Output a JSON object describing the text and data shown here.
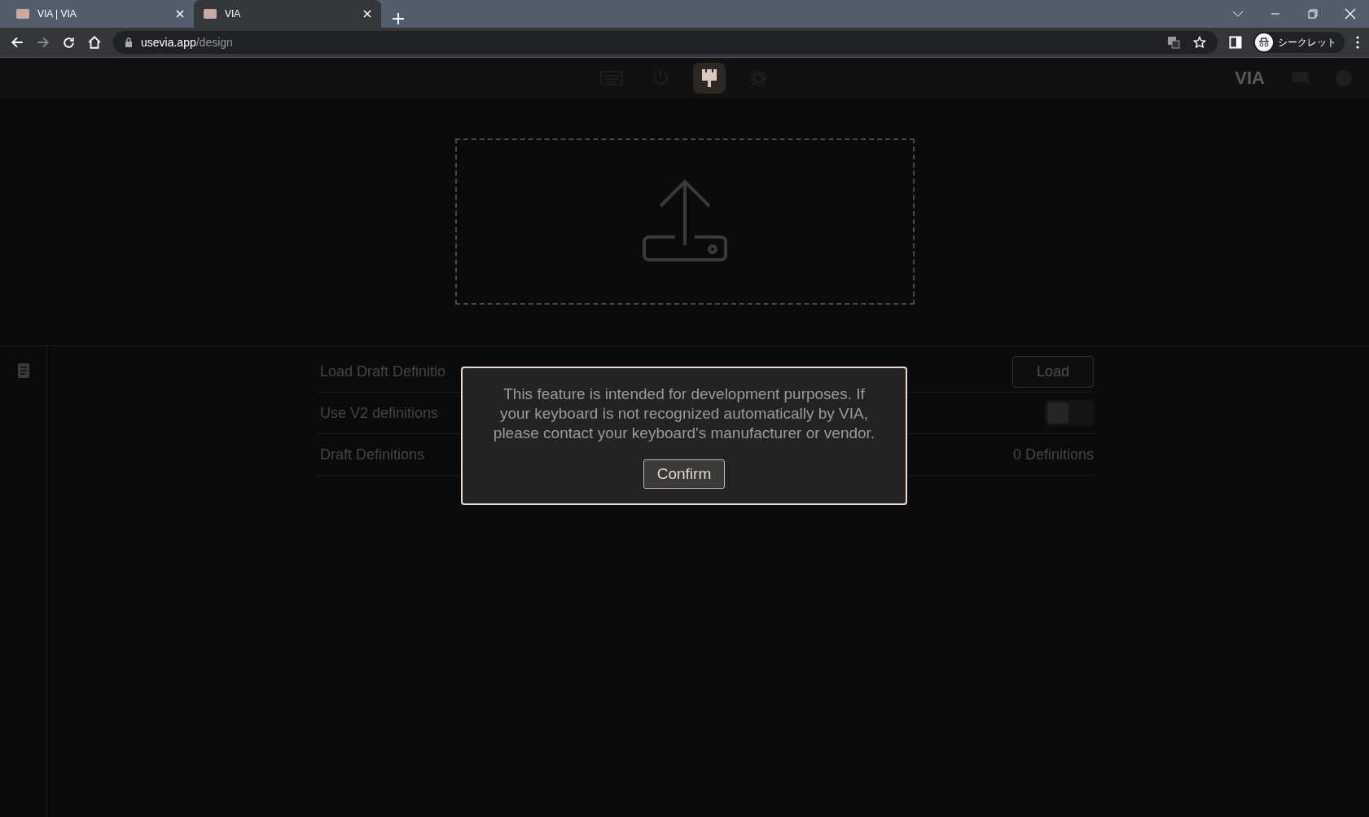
{
  "browser": {
    "tabs": [
      {
        "title": "VIA | VIA",
        "selected": false
      },
      {
        "title": "VIA",
        "selected": true
      }
    ],
    "url": {
      "host": "usevia.app",
      "path": "/design"
    },
    "profile": "シークレット"
  },
  "app": {
    "nav": [
      {
        "kind": "keyboard",
        "selected": false
      },
      {
        "kind": "plug",
        "selected": false
      },
      {
        "kind": "brush",
        "selected": true
      },
      {
        "kind": "gear",
        "selected": false
      }
    ],
    "logo": "VIA"
  },
  "settings": [
    {
      "kind": "button",
      "label": "Load Draft Definitio",
      "button": "Load"
    },
    {
      "kind": "toggle",
      "label": "Use V2 definitions",
      "on": false
    },
    {
      "kind": "value",
      "label": "Draft Definitions",
      "value": "0 Definitions"
    }
  ],
  "dialog": {
    "message": "This feature is intended for development purposes. If your keyboard is not recognized automatically by VIA, please contact your keyboard's manufacturer or vendor.",
    "button": "Confirm"
  }
}
